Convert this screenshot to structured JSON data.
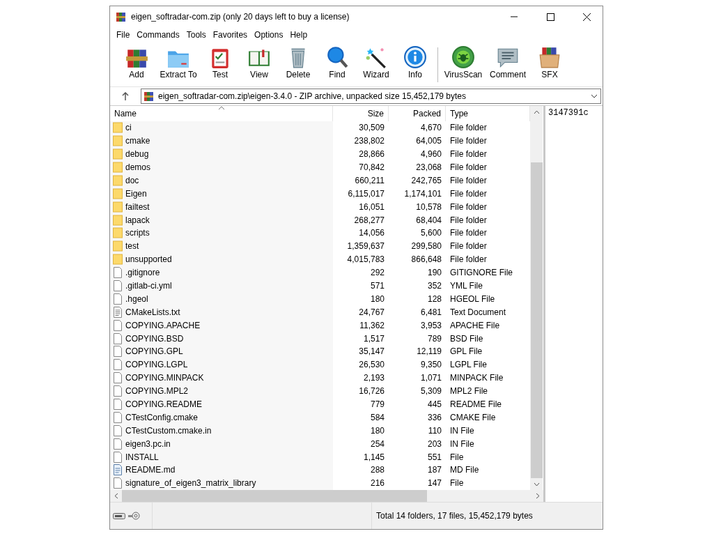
{
  "window": {
    "title": "eigen_softradar-com.zip (only 20 days left to buy a license)"
  },
  "menu": [
    "File",
    "Commands",
    "Tools",
    "Favorites",
    "Options",
    "Help"
  ],
  "toolbar": [
    {
      "label": "Add",
      "kind": "add"
    },
    {
      "label": "Extract To",
      "kind": "extract"
    },
    {
      "label": "Test",
      "kind": "test"
    },
    {
      "label": "View",
      "kind": "view"
    },
    {
      "label": "Delete",
      "kind": "delete"
    },
    {
      "label": "Find",
      "kind": "find"
    },
    {
      "label": "Wizard",
      "kind": "wizard"
    },
    {
      "label": "Info",
      "kind": "info"
    },
    {
      "label": "VirusScan",
      "kind": "virus"
    },
    {
      "label": "Comment",
      "kind": "comment"
    },
    {
      "label": "SFX",
      "kind": "sfx"
    }
  ],
  "address": {
    "path": "eigen_softradar-com.zip\\eigen-3.4.0 - ZIP archive, unpacked size 15,452,179 bytes"
  },
  "table": {
    "columns": [
      "Name",
      "Size",
      "Packed",
      "Type"
    ],
    "rows": [
      {
        "kind": "folder",
        "name": "ci",
        "size": "30,509",
        "packed": "4,670",
        "type": "File folder"
      },
      {
        "kind": "folder",
        "name": "cmake",
        "size": "238,802",
        "packed": "64,005",
        "type": "File folder"
      },
      {
        "kind": "folder",
        "name": "debug",
        "size": "28,866",
        "packed": "4,960",
        "type": "File folder"
      },
      {
        "kind": "folder",
        "name": "demos",
        "size": "70,842",
        "packed": "23,068",
        "type": "File folder"
      },
      {
        "kind": "folder",
        "name": "doc",
        "size": "660,211",
        "packed": "242,765",
        "type": "File folder"
      },
      {
        "kind": "folder",
        "name": "Eigen",
        "size": "6,115,017",
        "packed": "1,174,101",
        "type": "File folder"
      },
      {
        "kind": "folder",
        "name": "failtest",
        "size": "16,051",
        "packed": "10,578",
        "type": "File folder"
      },
      {
        "kind": "folder",
        "name": "lapack",
        "size": "268,277",
        "packed": "68,404",
        "type": "File folder"
      },
      {
        "kind": "folder",
        "name": "scripts",
        "size": "14,056",
        "packed": "5,600",
        "type": "File folder"
      },
      {
        "kind": "folder",
        "name": "test",
        "size": "1,359,637",
        "packed": "299,580",
        "type": "File folder"
      },
      {
        "kind": "folder",
        "name": "unsupported",
        "size": "4,015,783",
        "packed": "866,648",
        "type": "File folder"
      },
      {
        "kind": "file",
        "name": ".gitignore",
        "size": "292",
        "packed": "190",
        "type": "GITIGNORE File"
      },
      {
        "kind": "file",
        "name": ".gitlab-ci.yml",
        "size": "571",
        "packed": "352",
        "type": "YML File"
      },
      {
        "kind": "file",
        "name": ".hgeol",
        "size": "180",
        "packed": "128",
        "type": "HGEOL File"
      },
      {
        "kind": "text",
        "name": "CMakeLists.txt",
        "size": "24,767",
        "packed": "6,481",
        "type": "Text Document"
      },
      {
        "kind": "file",
        "name": "COPYING.APACHE",
        "size": "11,362",
        "packed": "3,953",
        "type": "APACHE File"
      },
      {
        "kind": "file",
        "name": "COPYING.BSD",
        "size": "1,517",
        "packed": "789",
        "type": "BSD File"
      },
      {
        "kind": "file",
        "name": "COPYING.GPL",
        "size": "35,147",
        "packed": "12,119",
        "type": "GPL File"
      },
      {
        "kind": "file",
        "name": "COPYING.LGPL",
        "size": "26,530",
        "packed": "9,350",
        "type": "LGPL File"
      },
      {
        "kind": "file",
        "name": "COPYING.MINPACK",
        "size": "2,193",
        "packed": "1,071",
        "type": "MINPACK File"
      },
      {
        "kind": "file",
        "name": "COPYING.MPL2",
        "size": "16,726",
        "packed": "5,309",
        "type": "MPL2 File"
      },
      {
        "kind": "file",
        "name": "COPYING.README",
        "size": "779",
        "packed": "445",
        "type": "README File"
      },
      {
        "kind": "file",
        "name": "CTestConfig.cmake",
        "size": "584",
        "packed": "336",
        "type": "CMAKE File"
      },
      {
        "kind": "file",
        "name": "CTestCustom.cmake.in",
        "size": "180",
        "packed": "110",
        "type": "IN File"
      },
      {
        "kind": "file",
        "name": "eigen3.pc.in",
        "size": "254",
        "packed": "203",
        "type": "IN File"
      },
      {
        "kind": "file",
        "name": "INSTALL",
        "size": "1,145",
        "packed": "551",
        "type": "File"
      },
      {
        "kind": "markdown",
        "name": "README.md",
        "size": "288",
        "packed": "187",
        "type": "MD File"
      },
      {
        "kind": "file",
        "name": "signature_of_eigen3_matrix_library",
        "size": "216",
        "packed": "147",
        "type": "File"
      }
    ]
  },
  "preview": {
    "text": "3147391c"
  },
  "status_bar": {
    "total": "Total 14 folders, 17 files, 15,452,179 bytes"
  }
}
